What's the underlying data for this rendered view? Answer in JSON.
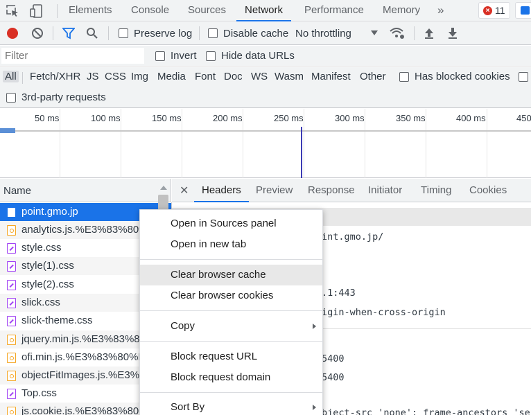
{
  "tabbar": {
    "tabs": [
      "Elements",
      "Console",
      "Sources",
      "Network",
      "Performance",
      "Memory"
    ],
    "active": "Network",
    "more": "»",
    "error_count": "11"
  },
  "toolbar": {
    "preserve_log": "Preserve log",
    "disable_cache": "Disable cache",
    "throttling": "No throttling"
  },
  "filter": {
    "placeholder": "Filter",
    "invert": "Invert",
    "hide_data_urls": "Hide data URLs"
  },
  "types": [
    "All",
    "Fetch/XHR",
    "JS",
    "CSS",
    "Img",
    "Media",
    "Font",
    "Doc",
    "WS",
    "Wasm",
    "Manifest",
    "Other"
  ],
  "has_blocked_cookies": "Has blocked cookies",
  "third_party": "3rd-party requests",
  "timeline": {
    "ticks": [
      "50 ms",
      "100 ms",
      "150 ms",
      "200 ms",
      "250 ms",
      "300 ms",
      "350 ms",
      "400 ms",
      "450"
    ]
  },
  "list": {
    "header": "Name",
    "requests": [
      {
        "name": "point.gmo.jp",
        "type": "doc"
      },
      {
        "name": "analytics.js.%E3%83%80%",
        "type": "js"
      },
      {
        "name": "style.css",
        "type": "css"
      },
      {
        "name": "style(1).css",
        "type": "css"
      },
      {
        "name": "style(2).css",
        "type": "css"
      },
      {
        "name": "slick.css",
        "type": "css"
      },
      {
        "name": "slick-theme.css",
        "type": "css"
      },
      {
        "name": "jquery.min.js.%E3%83%80",
        "type": "js"
      },
      {
        "name": "ofi.min.js.%E3%83%80%E",
        "type": "js"
      },
      {
        "name": "objectFitImages.js.%E3%8",
        "type": "js"
      },
      {
        "name": "Top.css",
        "type": "css"
      },
      {
        "name": "js.cookie.js.%E3%83%80",
        "type": "js"
      }
    ]
  },
  "details": {
    "tabs": [
      "Headers",
      "Preview",
      "Response",
      "Initiator",
      "Timing",
      "Cookies"
    ],
    "active": "Headers",
    "lines": [
      "int.gmo.jp/",
      ".1:443",
      "igin-when-cross-origin",
      "5400",
      "5400",
      "bject-src 'none'; frame-ancestors 'se"
    ]
  },
  "context_menu": {
    "items": [
      {
        "label": "Open in Sources panel"
      },
      {
        "label": "Open in new tab"
      },
      {
        "label": "Clear browser cache"
      },
      {
        "label": "Clear browser cookies"
      },
      {
        "label": "Copy"
      },
      {
        "label": "Block request URL"
      },
      {
        "label": "Block request domain"
      },
      {
        "label": "Sort By"
      }
    ]
  }
}
